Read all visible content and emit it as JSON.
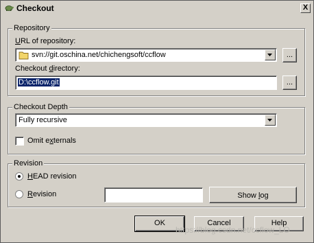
{
  "window": {
    "title": "Checkout",
    "close_label": "X"
  },
  "repository": {
    "group_label": "Repository",
    "url_label_prefix": "U",
    "url_label_rest": "RL of repository:",
    "url_value": "svn://git.oschina.net/chichengsoft/ccflow",
    "browse_label": "...",
    "dir_label_prefix": "Checkout ",
    "dir_label_u": "d",
    "dir_label_rest": "irectory:",
    "dir_value": "D:\\ccflow.git",
    "dir_browse_label": "..."
  },
  "depth": {
    "group_label": "Checkout Depth",
    "selected": "Fully recursive",
    "omit_prefix": "Omit e",
    "omit_u": "x",
    "omit_rest": "ternals",
    "omit_checked": false
  },
  "revision": {
    "group_label": "Revision",
    "head_u": "H",
    "head_rest": "EAD revision",
    "rev_u": "R",
    "rev_rest": "evision",
    "selected": "head",
    "revision_value": "",
    "showlog_prefix": "Show ",
    "showlog_u": "l",
    "showlog_rest": "og"
  },
  "buttons": {
    "ok": "OK",
    "cancel": "Cancel",
    "help": "Help"
  },
  "watermark": "https://blog.csdn.net/ccflow_LO"
}
